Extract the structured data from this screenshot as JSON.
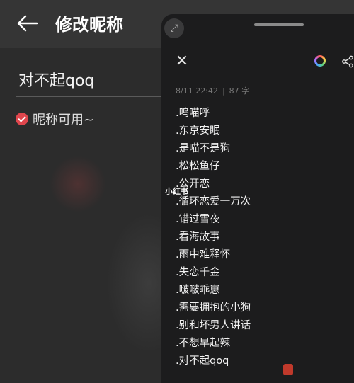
{
  "background_screen": {
    "title": "修改昵称",
    "nickname_value": "对不起qoq",
    "availability_text": "昵称可用~"
  },
  "floating_note": {
    "meta": {
      "datetime": "8/11 22:42",
      "word_count": "87 字"
    },
    "lines": [
      ".呜喵呼",
      ".东京安眠",
      ".是喵不是狗",
      ".松松鱼仔",
      ".公开恋",
      ".循环恋爱一万次",
      ".错过雪夜",
      ".看海故事",
      ".雨中难释怀",
      ".失恋千金",
      ".啵啵乖崽",
      ".需要拥抱的小狗",
      ".别和坏男人讲话",
      ".不想早起辣",
      ".对不起qoq"
    ]
  },
  "watermark": "小红书",
  "icons": {
    "back": "arrow-left-icon",
    "check": "check-circle-icon",
    "expand": "expand-icon",
    "close": "close-icon",
    "color": "color-palette-icon",
    "share": "share-icon"
  },
  "colors": {
    "accent_red": "#e0464d",
    "panel_bg": "#1c1c1d",
    "screen_bg": "#2c2c2c"
  }
}
